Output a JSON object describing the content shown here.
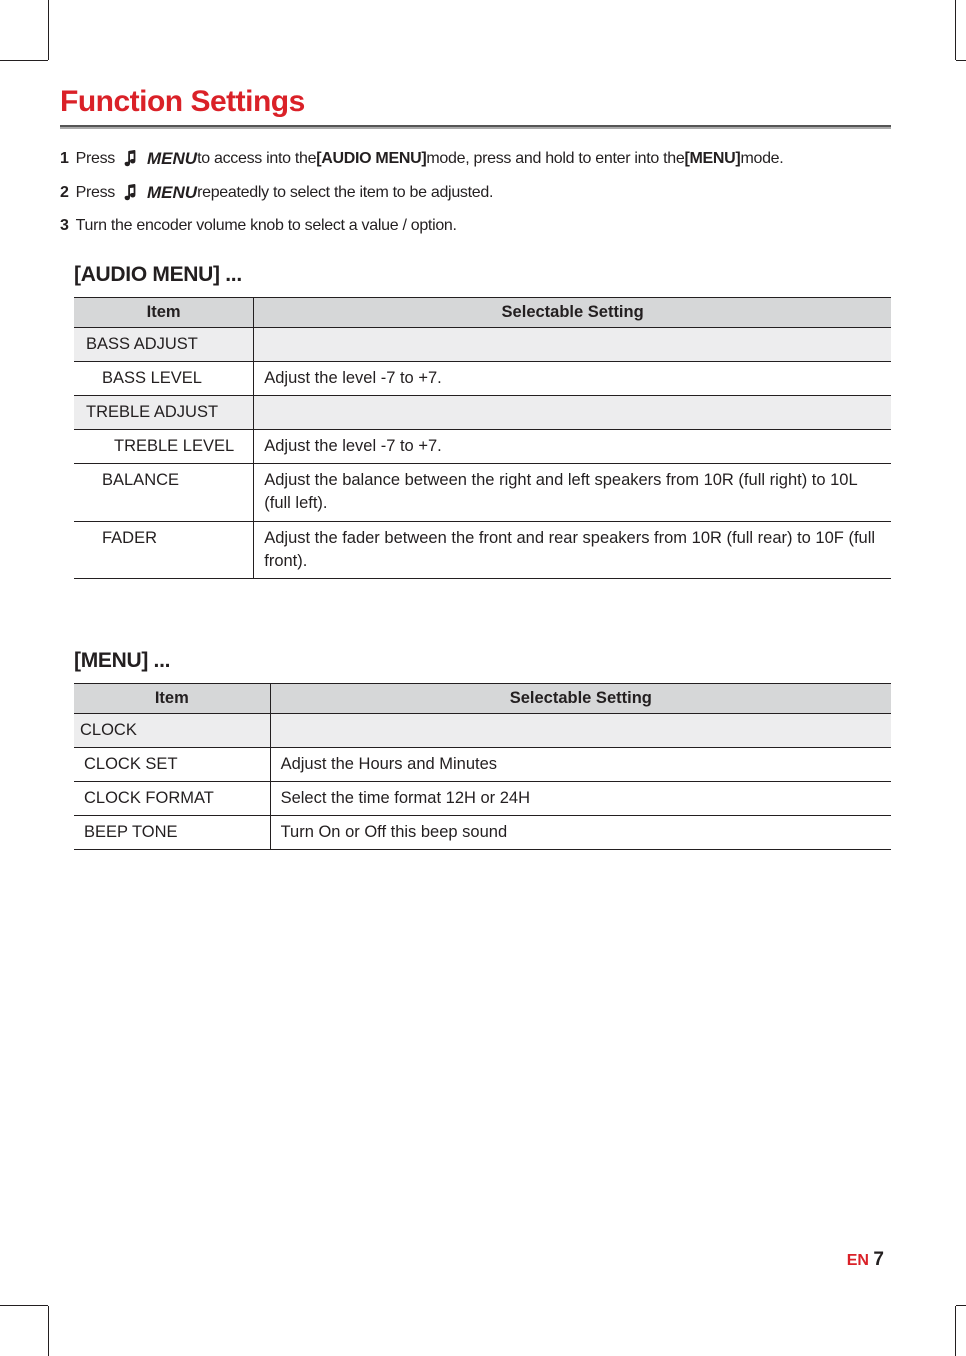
{
  "title": "Function  Settings",
  "steps": [
    {
      "num": "1",
      "pre": "Press",
      "menu_word": "MENU",
      "post_parts": [
        {
          "t": "  to access into the ",
          "b": false
        },
        {
          "t": "[AUDIO MENU]",
          "b": true
        },
        {
          "t": " mode, press and hold to enter into  the ",
          "b": false
        },
        {
          "t": "[MENU]",
          "b": true
        },
        {
          "t": " mode.",
          "b": false
        }
      ]
    },
    {
      "num": "2",
      "pre": "Press",
      "menu_word": "MENU",
      "post_parts": [
        {
          "t": "  repeatedly to select the item to be adjusted.",
          "b": false
        }
      ]
    },
    {
      "num": "3",
      "pre": "Turn the encoder volume knob to select a value / option.",
      "menu_word": null,
      "post_parts": []
    }
  ],
  "audio_menu": {
    "heading": "[AUDIO MENU] ...",
    "col_item": "Item",
    "col_setting": "Selectable Setting",
    "rows": [
      {
        "item": "BASS ADJUST",
        "setting": "",
        "group": true,
        "indent": 0
      },
      {
        "item": "BASS LEVEL",
        "setting": "Adjust the level -7 to +7.",
        "group": false,
        "indent": 1
      },
      {
        "item": "TREBLE ADJUST",
        "setting": "",
        "group": true,
        "indent": 0
      },
      {
        "item": "TREBLE LEVEL",
        "setting": "Adjust the level -7 to +7.",
        "group": false,
        "indent": 2
      },
      {
        "item": "BALANCE",
        "setting": "Adjust the balance between the right and left speakers from 10R (full right) to 10L (full left).",
        "group": false,
        "indent": 1
      },
      {
        "item": "FADER",
        "setting": "Adjust the fader between the front and rear speakers from 10R (full rear) to 10F (full front).",
        "group": false,
        "indent": 1
      }
    ]
  },
  "menu": {
    "heading": "[MENU] ...",
    "col_item": "Item",
    "col_setting": "Selectable Setting",
    "rows": [
      {
        "item": "CLOCK",
        "setting": "",
        "group": true,
        "indent": -1
      },
      {
        "item": "CLOCK SET",
        "setting": "Adjust the Hours and Minutes",
        "group": false,
        "indent": 0
      },
      {
        "item": "CLOCK FORMAT",
        "setting": "Select the time format 12H or 24H",
        "group": false,
        "indent": 0
      },
      {
        "item": "BEEP TONE",
        "setting": "Turn On or Off this beep sound",
        "group": false,
        "indent": 0
      }
    ]
  },
  "footer": {
    "en": "EN",
    "num": "7"
  }
}
